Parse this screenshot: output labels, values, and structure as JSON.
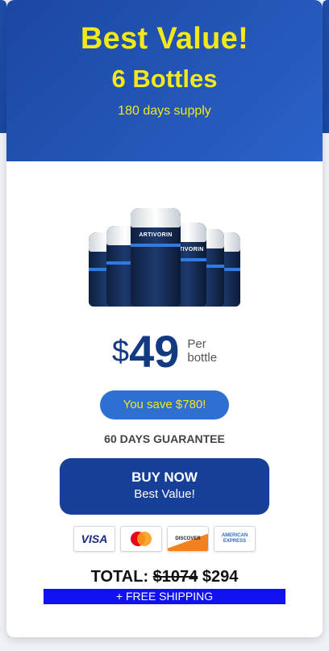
{
  "header": {
    "title": "Best Value!",
    "quantity": "6 Bottles",
    "supply": "180 days supply"
  },
  "product": {
    "brand": "ARTIVORIN",
    "bottle_count": 6
  },
  "price": {
    "currency": "$",
    "amount": "49",
    "unit_line1": "Per",
    "unit_line2": "bottle"
  },
  "savings": "You save $780!",
  "guarantee": "60 DAYS GUARANTEE",
  "buy_button": {
    "label": "BUY NOW",
    "sub": "Best Value!"
  },
  "payments": [
    {
      "name": "VISA",
      "icon": "visa-card-icon"
    },
    {
      "name": "mastercard",
      "icon": "mastercard-icon"
    },
    {
      "name": "DISCOVER",
      "icon": "discover-card-icon"
    },
    {
      "name": "AMERICAN EXPRESS",
      "icon": "amex-card-icon"
    }
  ],
  "total": {
    "label": "TOTAL:",
    "old_price": "$1074",
    "new_price": "$294"
  },
  "shipping": "+ FREE SHIPPING",
  "colors": {
    "header_blue": "#1c47a2",
    "accent_yellow": "#f3e81a",
    "button_blue": "#163f98",
    "shipping_blue": "#1010f0"
  }
}
